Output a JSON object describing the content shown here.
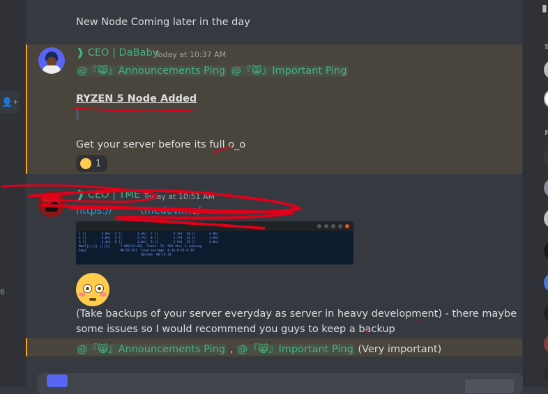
{
  "messages": {
    "intro": "New Node Coming later in the day",
    "dababy": {
      "username": "❱ CEO | DaBaby",
      "timestamp": "Today at 10:37 AM",
      "mention1": "@『😸』Announcements Ping",
      "mention2": "@『😸』Important Ping",
      "heading": "RYZEN 5 Node Added",
      "body": "Get your server before its full",
      "body_suffix": "o_o",
      "reaction_count": "1"
    },
    "tme": {
      "username": "❱ CEO | TME",
      "timestamp": "Today at 10:51 AM",
      "link": "https://",
      "link_rest": "tmedev.me/",
      "backup_line1": "(Take backups of your server everyday as server in heavy development) - there maybe",
      "backup_line2": "some issues so I would recommend you guys to keep a backup",
      "mention1": "@『😸』Announcements Ping",
      "separator": ",",
      "mention2": "@『😸』Important Ping",
      "suffix": "(Very important)"
    }
  },
  "terminal": {
    "lines": "1 [|        3.9%]  4 [|        3.3%]  7 [|        4.1%]  10 [|       4.0%]\n2 [|        1.0%]  5 [|        2.7%]  8 [|        1.7%]  11 [|       1.6%]\n3 [|        1.4%]  6 [|        4.0%]  9 [|        1.3%]  12 [|       4.0%]\nMem[|||||| ||||||     7.09G/62.8G]  Tasks: 72, 592 thr; 3 running\nSwp[                  0K/32.0G]  Load average: 0.36 0.41 0.14\n                                 Uptime: 00:14:28"
  },
  "left_strip": {
    "edge_number": "6"
  },
  "right_strip": {
    "letter_s": "S",
    "letter_p": "P"
  },
  "colors": {
    "accent_green": "#43b581",
    "highlight_bg": "#49443c",
    "highlight_bar": "#faa81a",
    "scribble_red": "#e0001a"
  }
}
